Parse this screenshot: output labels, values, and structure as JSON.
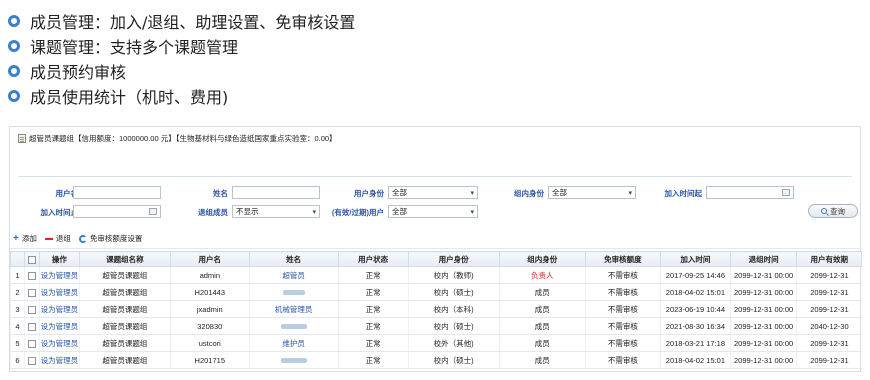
{
  "bullets": [
    "成员管理：加入/退组、助理设置、免审核设置",
    "课题管理：支持多个课题管理",
    "成员预约审核",
    "成员使用统计（机时、费用)"
  ],
  "panel": {
    "title": "超管员课题组【信用额度：1000000.00 元】【生物基材料与绿色造纸国家重点实验室：0.00】"
  },
  "form": {
    "user_name_label": "用户名",
    "name_label": "姓名",
    "user_role_label": "用户身份",
    "user_role_value": "全部",
    "group_role_label": "组内身份",
    "group_role_value": "全部",
    "join_start_label": "加入时间起",
    "join_end_label": "加入时间止",
    "leave_member_label": "退组成员",
    "leave_member_value": "不显示",
    "valid_label": "(有效/过期)用户",
    "valid_value": "全部",
    "search_label": "查询"
  },
  "toolbar": {
    "add_label": "添加",
    "remove_label": "退组",
    "exempt_label": "免审核额度设置"
  },
  "table": {
    "headers": [
      "",
      "操作",
      "课题组名称",
      "用户名",
      "姓名",
      "用户状态",
      "用户身份",
      "组内身份",
      "免审核额度",
      "加入时间",
      "退组时间",
      "用户有效期"
    ],
    "rows": [
      {
        "num": "1",
        "op": "设为管理员",
        "group": "超管员课题组",
        "user": "admin",
        "name": "超管员",
        "status": "正常",
        "role": "校内（教师)",
        "inrole": "负责人",
        "quota": "不需审核",
        "join": "2017-09-25 14:46",
        "leave": "2099-12-31 00:00",
        "expire": "2099-12-31"
      },
      {
        "num": "2",
        "op": "设为管理员",
        "group": "超管员课题组",
        "user": "H201443",
        "name": "",
        "status": "正常",
        "role": "校内（硕士)",
        "inrole": "成员",
        "quota": "不需审核",
        "join": "2018-04-02 15:01",
        "leave": "2099-12-31 00:00",
        "expire": "2099-12-31"
      },
      {
        "num": "3",
        "op": "设为管理员",
        "group": "超管员课题组",
        "user": "jxadmin",
        "name": "机械管理员",
        "status": "正常",
        "role": "校内（本科)",
        "inrole": "成员",
        "quota": "不需审核",
        "join": "2023-06-19 10:44",
        "leave": "2099-12-31 00:00",
        "expire": "2099-12-31"
      },
      {
        "num": "4",
        "op": "设为管理员",
        "group": "超管员课题组",
        "user": "320830",
        "name": "",
        "status": "正常",
        "role": "校内（硕士)",
        "inrole": "成员",
        "quota": "不需审核",
        "join": "2021-08-30 16:34",
        "leave": "2099-12-31 00:00",
        "expire": "2040-12-30"
      },
      {
        "num": "5",
        "op": "设为管理员",
        "group": "超管员课题组",
        "user": "ustcori",
        "name": "维护员",
        "status": "正常",
        "role": "校外（其他)",
        "inrole": "成员",
        "quota": "不需审核",
        "join": "2018-03-21 17:18",
        "leave": "2099-12-31 00:00",
        "expire": "2099-12-31"
      },
      {
        "num": "6",
        "op": "设为管理员",
        "group": "超管员课题组",
        "user": "H201715",
        "name": "",
        "status": "正常",
        "role": "校内（硕士)",
        "inrole": "成员",
        "quota": "不需审核",
        "join": "2018-04-02 15:01",
        "leave": "2099-12-31 00:00",
        "expire": "2099-12-31"
      }
    ]
  },
  "colors": {
    "accent": "#2a56a5",
    "danger": "#d9262c",
    "bullet": "#3d7fcf"
  }
}
